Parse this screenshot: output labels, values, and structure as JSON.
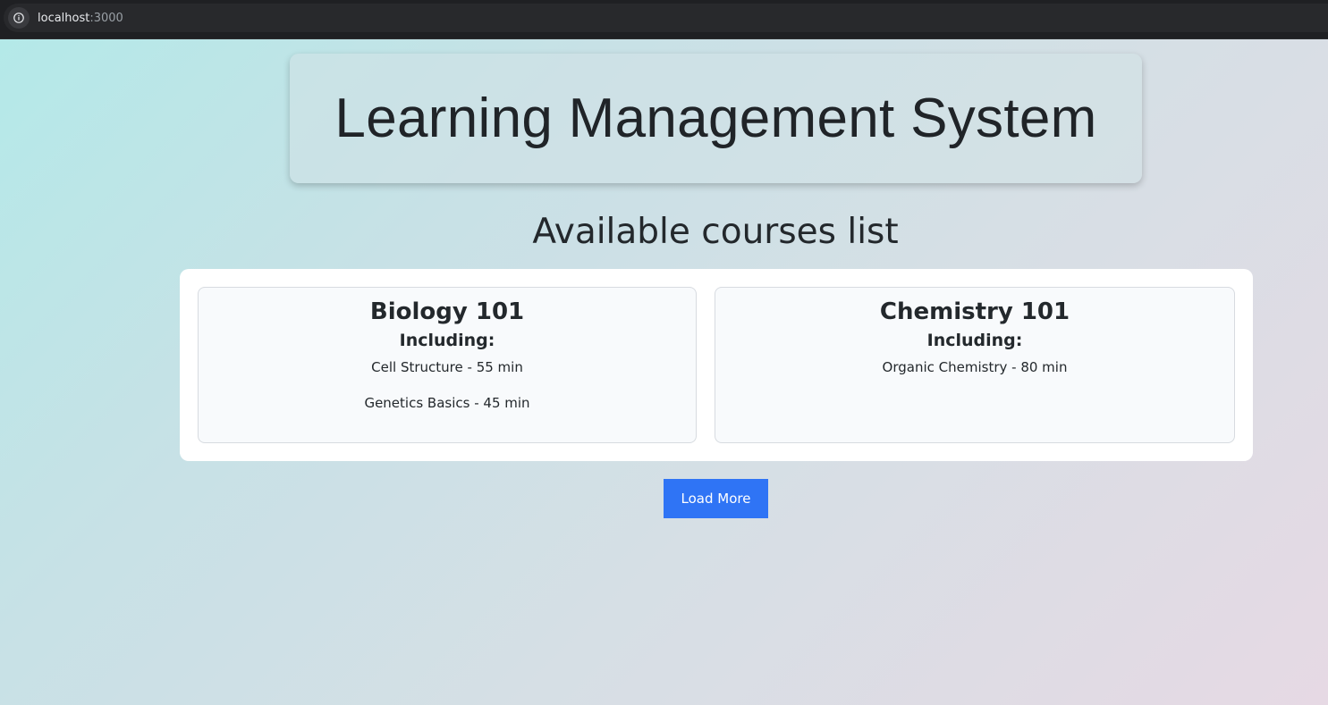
{
  "browser": {
    "url_host": "localhost",
    "url_port": ":3000"
  },
  "header": {
    "title": "Learning Management System"
  },
  "courses_section": {
    "title": "Available courses list",
    "courses": [
      {
        "name": "Biology 101",
        "including_label": "Including:",
        "lessons": [
          "Cell Structure - 55 min",
          "Genetics Basics - 45 min"
        ]
      },
      {
        "name": "Chemistry 101",
        "including_label": "Including:",
        "lessons": [
          "Organic Chemistry - 80 min"
        ]
      }
    ]
  },
  "actions": {
    "load_more_label": "Load More"
  },
  "colors": {
    "button": "#2f74f5",
    "text": "#23282c",
    "gradient_start": "#b4e9e8",
    "gradient_end": "#e6d9e4"
  }
}
